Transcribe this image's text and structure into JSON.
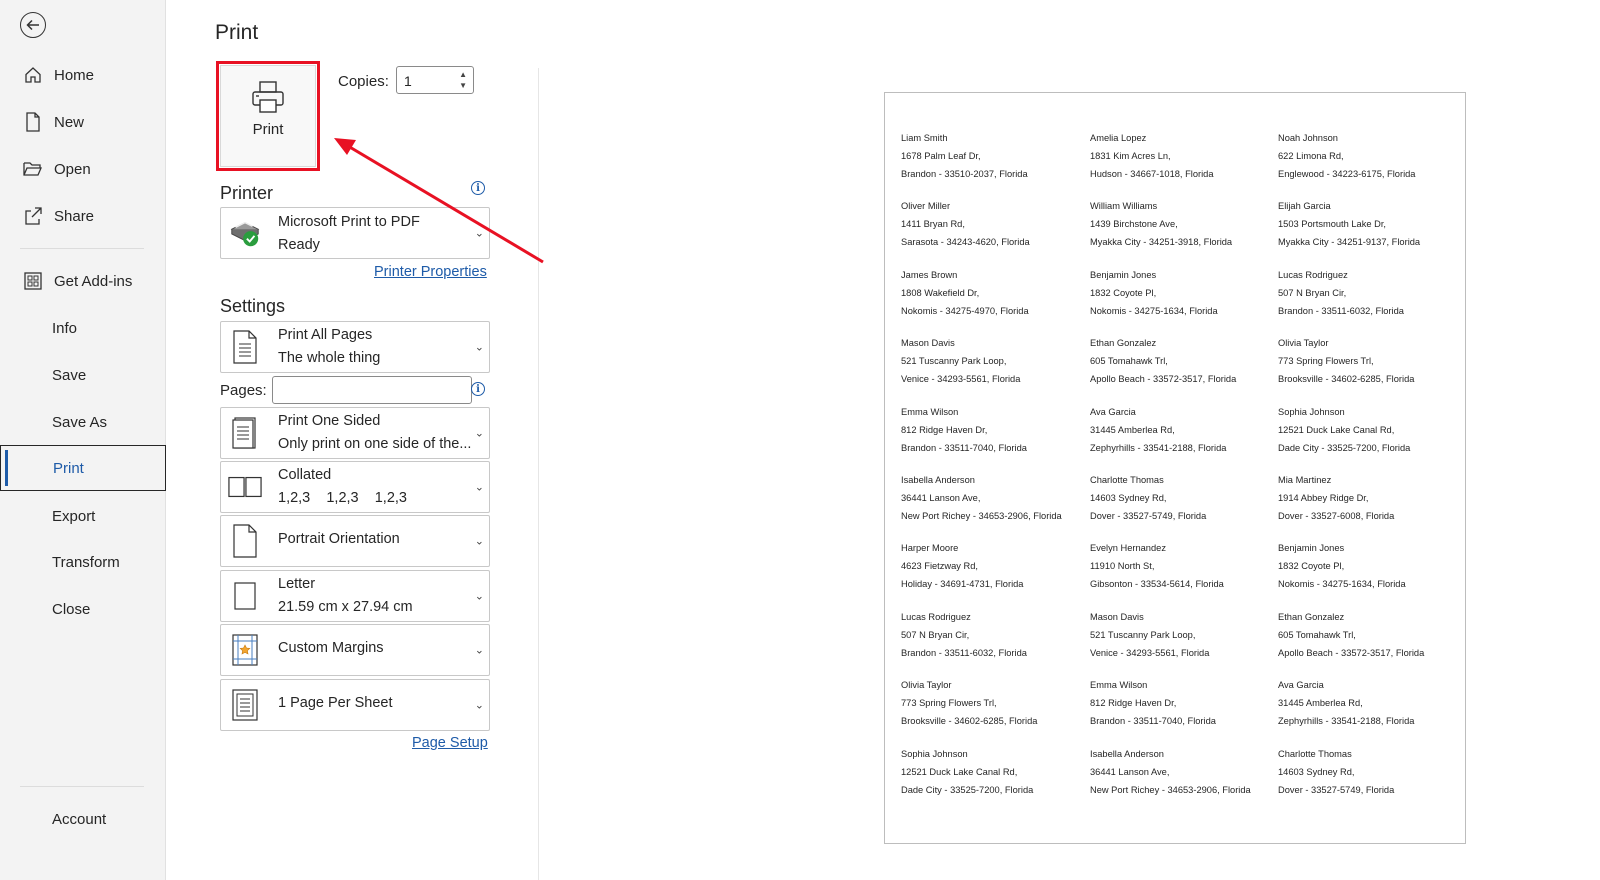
{
  "nav": {
    "items": [
      {
        "label": "Home"
      },
      {
        "label": "New"
      },
      {
        "label": "Open"
      },
      {
        "label": "Share"
      },
      {
        "label": "Get Add-ins"
      },
      {
        "label": "Info"
      },
      {
        "label": "Save"
      },
      {
        "label": "Save As"
      },
      {
        "label": "Print"
      },
      {
        "label": "Export"
      },
      {
        "label": "Transform"
      },
      {
        "label": "Close"
      },
      {
        "label": "Account"
      }
    ],
    "active": "Print"
  },
  "print": {
    "title": "Print",
    "button_label": "Print",
    "copies_label": "Copies:",
    "copies_value": "1"
  },
  "printer": {
    "heading": "Printer",
    "name": "Microsoft Print to PDF",
    "status": "Ready",
    "properties_link": "Printer Properties"
  },
  "settings": {
    "heading": "Settings",
    "pages_label": "Pages:",
    "pages_value": "",
    "page_setup_link": "Page Setup",
    "options": [
      {
        "main": "Print All Pages",
        "sub": "The whole thing",
        "icon": "page-range-icon"
      },
      {
        "main": "Print One Sided",
        "sub": "Only print on one side of the...",
        "icon": "one-sided-icon"
      },
      {
        "main": "Collated",
        "sub": "1,2,3    1,2,3    1,2,3",
        "icon": "collated-icon"
      },
      {
        "main": "Portrait Orientation",
        "sub": "",
        "icon": "portrait-icon"
      },
      {
        "main": "Letter",
        "sub": "21.59 cm x 27.94 cm",
        "icon": "paper-size-icon"
      },
      {
        "main": "Custom Margins",
        "sub": "",
        "icon": "margins-icon"
      },
      {
        "main": "1 Page Per Sheet",
        "sub": "",
        "icon": "pages-per-sheet-icon"
      }
    ]
  },
  "preview": {
    "labels": [
      [
        {
          "name": "Liam Smith",
          "street": "1678 Palm Leaf Dr,",
          "city": "Brandon - 33510-2037, Florida"
        },
        {
          "name": "Amelia Lopez",
          "street": "1831 Kim Acres Ln,",
          "city": "Hudson - 34667-1018, Florida"
        },
        {
          "name": "Noah Johnson",
          "street": "622 Limona Rd,",
          "city": "Englewood - 34223-6175, Florida"
        }
      ],
      [
        {
          "name": "Oliver Miller",
          "street": "1411 Bryan Rd,",
          "city": "Sarasota - 34243-4620, Florida"
        },
        {
          "name": "William Williams",
          "street": "1439 Birchstone Ave,",
          "city": "Myakka City - 34251-3918, Florida"
        },
        {
          "name": "Elijah Garcia",
          "street": "1503 Portsmouth Lake Dr,",
          "city": "Myakka City - 34251-9137, Florida"
        }
      ],
      [
        {
          "name": "James Brown",
          "street": "1808 Wakefield Dr,",
          "city": "Nokomis - 34275-4970, Florida"
        },
        {
          "name": "Benjamin Jones",
          "street": "1832 Coyote Pl,",
          "city": "Nokomis - 34275-1634, Florida"
        },
        {
          "name": "Lucas Rodriguez",
          "street": "507 N Bryan Cir,",
          "city": "Brandon - 33511-6032, Florida"
        }
      ],
      [
        {
          "name": "Mason Davis",
          "street": "521 Tuscanny Park Loop,",
          "city": "Venice - 34293-5561, Florida"
        },
        {
          "name": "Ethan Gonzalez",
          "street": "605 Tomahawk Trl,",
          "city": "Apollo Beach - 33572-3517, Florida"
        },
        {
          "name": "Olivia Taylor",
          "street": "773 Spring Flowers Trl,",
          "city": "Brooksville - 34602-6285, Florida"
        }
      ],
      [
        {
          "name": "Emma Wilson",
          "street": "812 Ridge Haven Dr,",
          "city": "Brandon - 33511-7040, Florida"
        },
        {
          "name": "Ava Garcia",
          "street": "31445 Amberlea Rd,",
          "city": "Zephyrhills - 33541-2188, Florida"
        },
        {
          "name": "Sophia Johnson",
          "street": "12521 Duck Lake Canal Rd,",
          "city": "Dade City - 33525-7200, Florida"
        }
      ],
      [
        {
          "name": "Isabella Anderson",
          "street": "36441 Lanson Ave,",
          "city": "New Port Richey - 34653-2906, Florida"
        },
        {
          "name": "Charlotte Thomas",
          "street": "14603 Sydney Rd,",
          "city": "Dover - 33527-5749, Florida"
        },
        {
          "name": "Mia Martinez",
          "street": "1914 Abbey Ridge Dr,",
          "city": "Dover - 33527-6008, Florida"
        }
      ],
      [
        {
          "name": "Harper Moore",
          "street": "4623 Fietzway Rd,",
          "city": "Holiday - 34691-4731, Florida"
        },
        {
          "name": "Evelyn Hernandez",
          "street": "11910 North St,",
          "city": "Gibsonton - 33534-5614, Florida"
        },
        {
          "name": "Benjamin Jones",
          "street": "1832 Coyote Pl,",
          "city": "Nokomis - 34275-1634, Florida"
        }
      ],
      [
        {
          "name": "Lucas Rodriguez",
          "street": "507 N Bryan Cir,",
          "city": "Brandon - 33511-6032, Florida"
        },
        {
          "name": "Mason Davis",
          "street": "521 Tuscanny Park Loop,",
          "city": "Venice - 34293-5561, Florida"
        },
        {
          "name": "Ethan Gonzalez",
          "street": "605 Tomahawk Trl,",
          "city": "Apollo Beach - 33572-3517, Florida"
        }
      ],
      [
        {
          "name": "Olivia Taylor",
          "street": "773 Spring Flowers Trl,",
          "city": "Brooksville - 34602-6285, Florida"
        },
        {
          "name": "Emma Wilson",
          "street": "812 Ridge Haven Dr,",
          "city": "Brandon - 33511-7040, Florida"
        },
        {
          "name": "Ava Garcia",
          "street": "31445 Amberlea Rd,",
          "city": "Zephyrhills - 33541-2188, Florida"
        }
      ],
      [
        {
          "name": "Sophia Johnson",
          "street": "12521 Duck Lake Canal Rd,",
          "city": "Dade City - 33525-7200, Florida"
        },
        {
          "name": "Isabella Anderson",
          "street": "36441 Lanson Ave,",
          "city": "New Port Richey - 34653-2906, Florida"
        },
        {
          "name": "Charlotte Thomas",
          "street": "14603 Sydney Rd,",
          "city": "Dover - 33527-5749, Florida"
        }
      ]
    ]
  },
  "colors": {
    "accent": "#1e5ba8",
    "highlight": "#e81123",
    "nav_bg": "#f3f3f3"
  }
}
